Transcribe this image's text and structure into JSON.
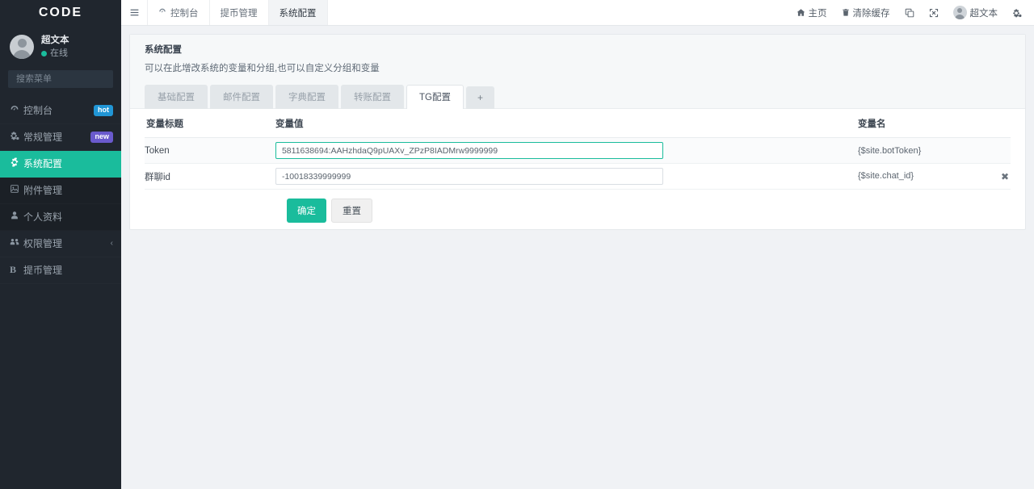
{
  "sidebar": {
    "brand": "CODE",
    "profile": {
      "name": "超文本",
      "status": "在线"
    },
    "search": {
      "placeholder": "搜索菜单",
      "value": "",
      "icon": "search-icon"
    },
    "items": [
      {
        "label": "控制台",
        "icon": "dashboard-icon",
        "glyph": "⛭",
        "badge": "hot",
        "badge_color": "#2196d6",
        "active": false,
        "dark": false
      },
      {
        "label": "常规管理",
        "icon": "cogs-icon",
        "glyph": "⚙",
        "badge": "new",
        "badge_color": "#6a5acd",
        "active": false,
        "dark": false
      },
      {
        "label": "系统配置",
        "icon": "gear-icon",
        "glyph": "⚙",
        "badge": "",
        "badge_color": "",
        "active": true,
        "dark": false
      },
      {
        "label": "附件管理",
        "icon": "image-file-icon",
        "glyph": "Ὓb",
        "badge": "",
        "badge_color": "",
        "active": false,
        "dark": true
      },
      {
        "label": "个人资料",
        "icon": "user-icon",
        "glyph": "♟",
        "badge": "",
        "badge_color": "",
        "active": false,
        "dark": true
      },
      {
        "label": "权限管理",
        "icon": "users-icon",
        "glyph": "☷",
        "badge": "",
        "badge_color": "",
        "active": false,
        "dark": false,
        "caret": "‹"
      },
      {
        "label": "提币管理",
        "icon": "bitcoin-icon",
        "glyph": "B",
        "badge": "",
        "badge_color": "",
        "active": false,
        "dark": false
      }
    ]
  },
  "topbar": {
    "menu_toggle_icon": "hamburger-icon",
    "tabs": [
      {
        "label": "控制台",
        "icon": "dashboard-icon",
        "glyph": "⛭",
        "active": false
      },
      {
        "label": "提币管理",
        "icon": "",
        "glyph": "",
        "active": false
      },
      {
        "label": "系统配置",
        "icon": "",
        "glyph": "",
        "active": true
      }
    ],
    "actions": [
      {
        "label": "主页",
        "icon": "home-icon",
        "glyph": "⌂"
      },
      {
        "label": "清除缓存",
        "icon": "trash-icon",
        "glyph": "Ὕ1"
      },
      {
        "label": "",
        "icon": "window-copy-icon",
        "glyph": "⧉"
      },
      {
        "label": "",
        "icon": "fullscreen-icon",
        "glyph": "⛶"
      },
      {
        "label": "超文本",
        "icon": "avatar-icon",
        "glyph": ""
      },
      {
        "label": "",
        "icon": "settings-cog-icon",
        "glyph": "⚙"
      }
    ]
  },
  "page": {
    "title": "系统配置",
    "description": "可以在此增改系统的变量和分组,也可以自定义分组和变量",
    "tabs": [
      {
        "label": "基础配置",
        "active": false
      },
      {
        "label": "邮件配置",
        "active": false
      },
      {
        "label": "字典配置",
        "active": false
      },
      {
        "label": "转账配置",
        "active": false
      },
      {
        "label": "TG配置",
        "active": true
      }
    ],
    "add_tab_label": "+"
  },
  "table": {
    "headers": {
      "title": "变量标题",
      "value": "变量值",
      "name": "变量名"
    },
    "rows": [
      {
        "title": "Token",
        "value": "5811638694:AAHzhdaQ9pUAXv_ZPzP8IADMrw9999999",
        "placeholder": "",
        "name": "{$site.botToken}",
        "focused": true,
        "zebra": true,
        "remove": ""
      },
      {
        "title": "群聊id",
        "value": "-10018339999999",
        "placeholder": "",
        "name": "{$site.chat_id}",
        "focused": false,
        "zebra": false,
        "remove": "✖"
      }
    ]
  },
  "form": {
    "submit_label": "确定",
    "reset_label": "重置"
  },
  "colors": {
    "accent": "#1abc9c",
    "sidebar_bg": "#20262e",
    "sidebar_dark": "#1b2026",
    "page_bg": "#f0f2f5",
    "badge_hot": "#2196d6",
    "badge_new": "#6a5acd"
  }
}
